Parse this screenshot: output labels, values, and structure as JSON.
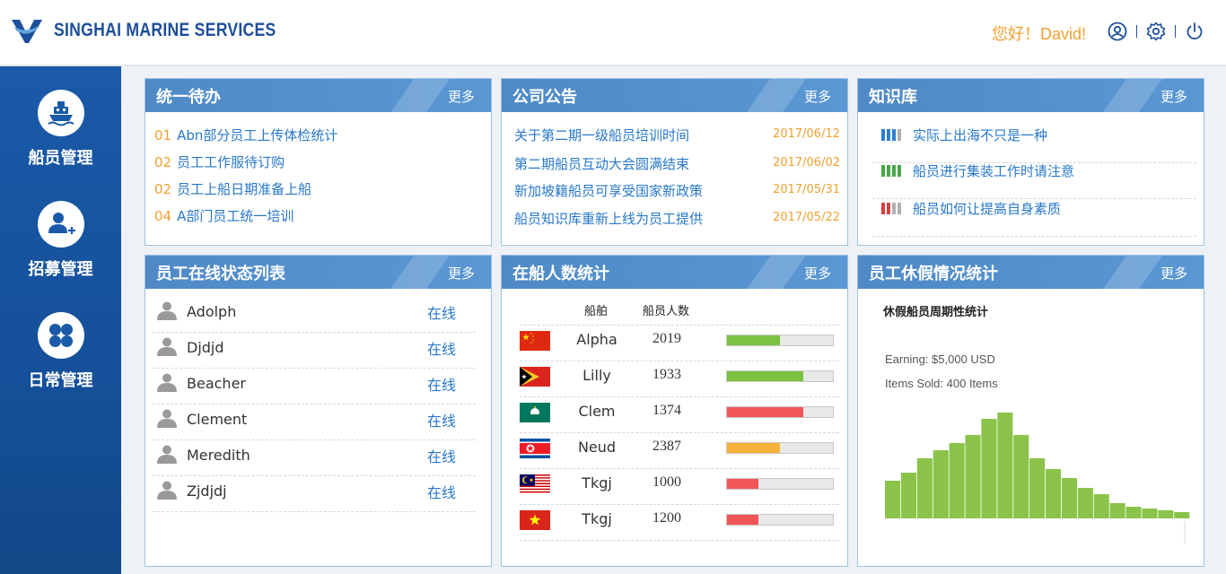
{
  "header": {
    "brand": "SINGHAI MARINE SERVICES",
    "greeting": "您好！David!"
  },
  "sidebar": {
    "items": [
      {
        "label": "船员管理",
        "icon": "ship-icon"
      },
      {
        "label": "招募管理",
        "icon": "add-user-icon"
      },
      {
        "label": "日常管理",
        "icon": "grid-icon"
      }
    ]
  },
  "more_label": "更多",
  "todo": {
    "title": "统一待办",
    "items": [
      {
        "num": "01",
        "text": "Abn部分员工上传体检统计"
      },
      {
        "num": "02",
        "text": "员工工作服待订购"
      },
      {
        "num": "02",
        "text": "员工上船日期准备上船"
      },
      {
        "num": "04",
        "text": "A部门员工统一培训"
      }
    ]
  },
  "notice": {
    "title": "公司公告",
    "items": [
      {
        "text": "关于第二期一级船员培训时间",
        "date": "2017/06/12"
      },
      {
        "text": "第二期船员互动大会圆满结束",
        "date": "2017/06/02"
      },
      {
        "text": "新加坡籍船员可享受国家新政策",
        "date": "2017/05/31"
      },
      {
        "text": "船员知识库重新上线为员工提供",
        "date": "2017/05/22"
      }
    ]
  },
  "knowledge": {
    "title": "知识库",
    "items": [
      {
        "text": "实际上出海不只是一种",
        "colors": [
          "#2e7fd0",
          "#2e7fd0",
          "#2e7fd0",
          "#b0b0b0"
        ]
      },
      {
        "text": "船员进行集装工作时请注意",
        "colors": [
          "#4aa64a",
          "#4aa64a",
          "#4aa64a",
          "#4aa64a"
        ]
      },
      {
        "text": "船员如何让提高自身素质",
        "colors": [
          "#d84040",
          "#d84040",
          "#b0b0b0",
          "#b0b0b0"
        ]
      }
    ]
  },
  "online": {
    "title": "员工在线状态列表",
    "items": [
      {
        "name": "Adolph",
        "status": "在线"
      },
      {
        "name": "Djdjd",
        "status": "在线"
      },
      {
        "name": "Beacher",
        "status": "在线"
      },
      {
        "name": "Clement",
        "status": "在线"
      },
      {
        "name": "Meredith",
        "status": "在线"
      },
      {
        "name": "Zjdjdj",
        "status": "在线"
      }
    ]
  },
  "onboard": {
    "title": "在船人数统计",
    "col_ship": "船舶",
    "col_count": "船员人数",
    "rows": [
      {
        "flag": "china",
        "ship": "Alpha",
        "count": "2019",
        "level": 0.5,
        "color": "#7cc241"
      },
      {
        "flag": "timor",
        "ship": "Lilly",
        "count": "1933",
        "level": 0.72,
        "color": "#7cc241"
      },
      {
        "flag": "macau",
        "ship": "Clem",
        "count": "1374",
        "level": 0.72,
        "color": "#f25555"
      },
      {
        "flag": "nkorea",
        "ship": "Neud",
        "count": "2387",
        "level": 0.5,
        "color": "#f5b23a"
      },
      {
        "flag": "malaysia",
        "ship": "Tkgj",
        "count": "1000",
        "level": 0.3,
        "color": "#f25555"
      },
      {
        "flag": "vietnam",
        "ship": "Tkgj",
        "count": "1200",
        "level": 0.3,
        "color": "#f25555"
      }
    ]
  },
  "leave": {
    "title": "员工休假情况统计",
    "subtitle": "休假船员周期性统计",
    "earning": "Earning: $5,000 USD",
    "items_sold": "Items Sold: 400 Items"
  },
  "chart_data": {
    "type": "bar",
    "color": "#8bc34a",
    "values": [
      42,
      51,
      67,
      76,
      84,
      93,
      111,
      118,
      93,
      67,
      55,
      45,
      34,
      27,
      17,
      13,
      11,
      9,
      7
    ]
  }
}
